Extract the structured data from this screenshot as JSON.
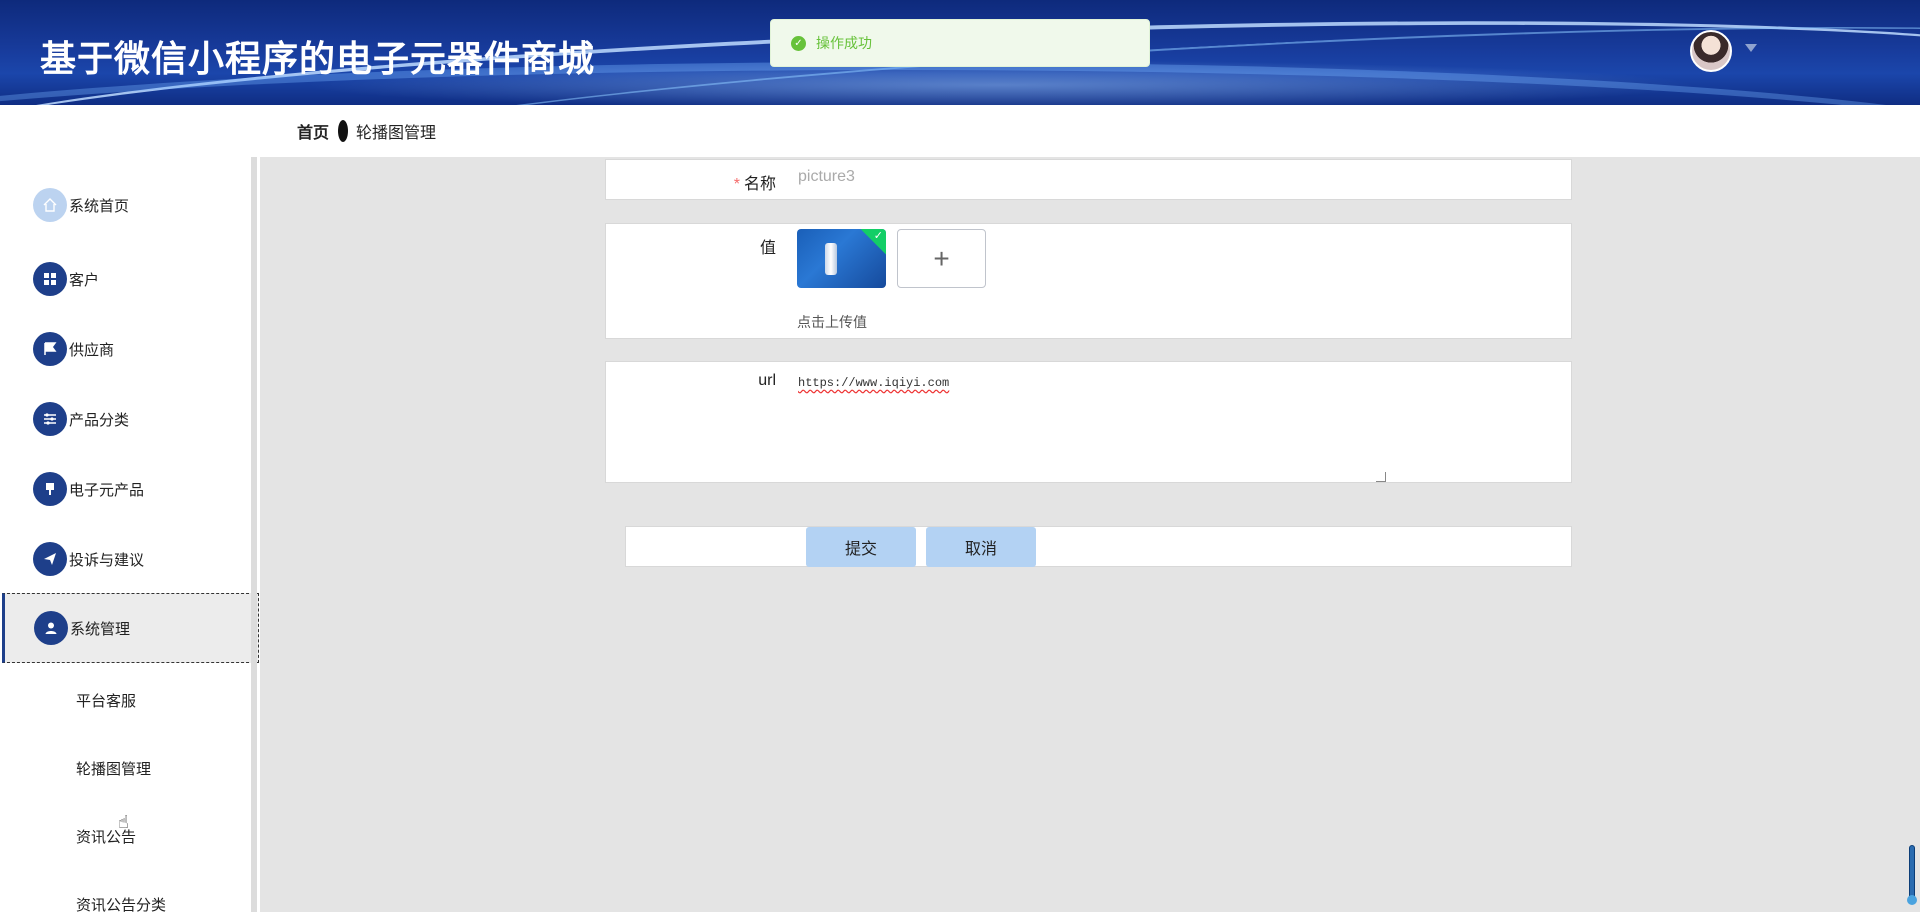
{
  "header": {
    "title": "基于微信小程序的电子元器件商城"
  },
  "toast": {
    "message": "操作成功",
    "icon": "success-check-icon",
    "color": "#67c23a"
  },
  "breadcrumb": {
    "home": "首页",
    "current": "轮播图管理"
  },
  "sidebar": {
    "items": [
      {
        "label": "系统首页",
        "icon": "home-icon"
      },
      {
        "label": "客户",
        "icon": "grid-icon"
      },
      {
        "label": "供应商",
        "icon": "flag-icon"
      },
      {
        "label": "产品分类",
        "icon": "sliders-icon"
      },
      {
        "label": "电子元产品",
        "icon": "brush-icon"
      },
      {
        "label": "投诉与建议",
        "icon": "send-icon"
      },
      {
        "label": "系统管理",
        "icon": "user-icon",
        "active": true
      }
    ],
    "sub_items": [
      {
        "label": "平台客服"
      },
      {
        "label": "轮播图管理"
      },
      {
        "label": "资讯公告"
      },
      {
        "label": "资讯公告分类"
      }
    ]
  },
  "form": {
    "name": {
      "label": "名称",
      "value": "picture3",
      "required": true
    },
    "value": {
      "label": "值",
      "upload_hint": "点击上传值",
      "upload_plus": "+"
    },
    "url": {
      "label": "url",
      "value": "https://www.iqiyi.com"
    }
  },
  "buttons": {
    "submit": "提交",
    "cancel": "取消"
  },
  "colors": {
    "header_blue": "#173a9a",
    "menu_icon_bg": "#1e3f8a",
    "button_bg": "#b3d2f3",
    "required_star": "#f56c6c"
  }
}
